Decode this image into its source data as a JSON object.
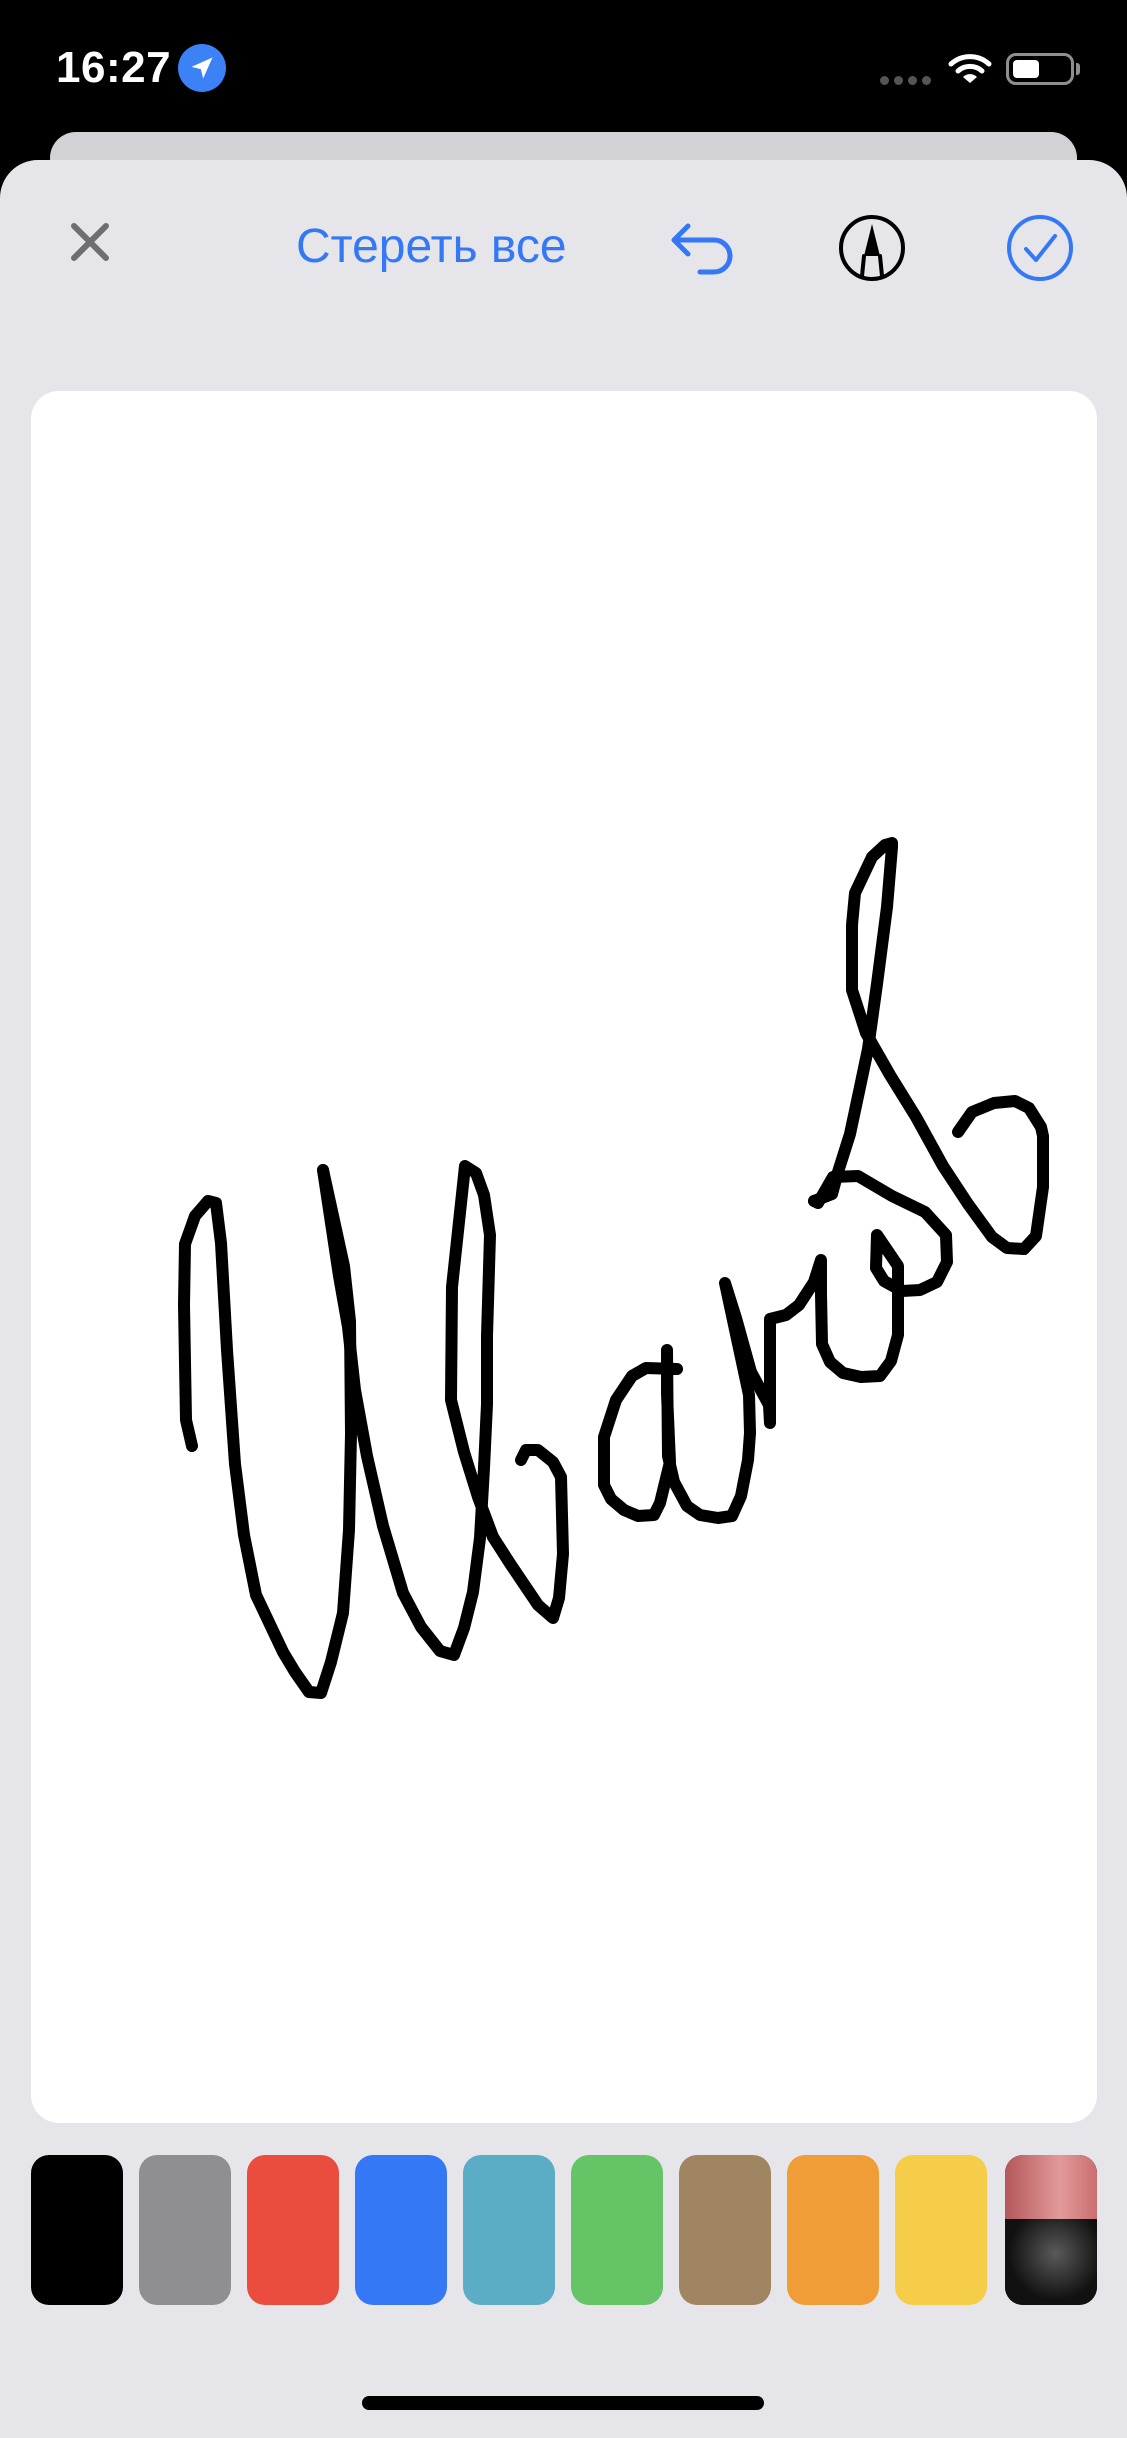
{
  "status_bar": {
    "time": "16:27",
    "icons": [
      "location-arrow-icon",
      "cellular-dots-icon",
      "wifi-icon",
      "battery-icon"
    ]
  },
  "toolbar": {
    "close_icon": "close-icon",
    "clear_label": "Стереть все",
    "undo_icon": "undo-icon",
    "pen_icon": "pen-tool-icon",
    "done_icon": "checkmark-circle-icon",
    "accent_color": "#3478f6"
  },
  "canvas": {
    "background": "#ffffff",
    "stroke_color": "#000000"
  },
  "palette": {
    "colors": [
      {
        "name": "black",
        "hex": "#000000"
      },
      {
        "name": "gray",
        "hex": "#8e8e93"
      },
      {
        "name": "red",
        "hex": "#ea4c3e"
      },
      {
        "name": "blue",
        "hex": "#3478f6"
      },
      {
        "name": "teal",
        "hex": "#5aadc5"
      },
      {
        "name": "green",
        "hex": "#65c466"
      },
      {
        "name": "brown",
        "hex": "#a08563"
      },
      {
        "name": "orange",
        "hex": "#f09d38"
      },
      {
        "name": "yellow",
        "hex": "#f6cd48"
      }
    ],
    "eraser_icon": "eraser-icon"
  }
}
